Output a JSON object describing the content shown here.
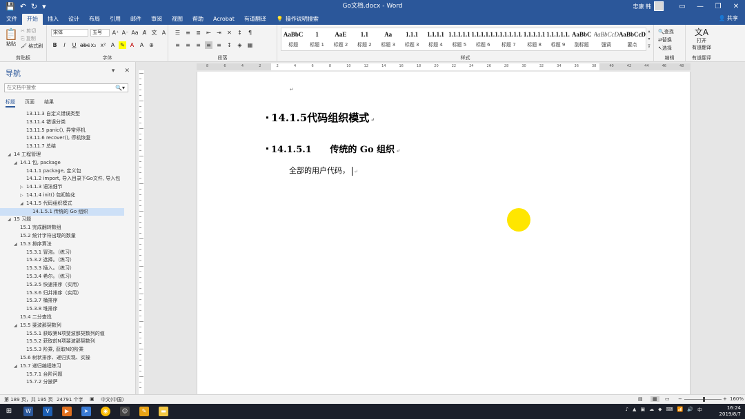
{
  "window": {
    "title": "Go文档.docx  -  Word",
    "user_name": "忠康 韩"
  },
  "quick_access": {
    "save_icon": "save-icon",
    "undo_icon": "undo-icon",
    "redo_icon": "redo-icon"
  },
  "tabs": [
    "文件",
    "开始",
    "插入",
    "设计",
    "布局",
    "引用",
    "邮件",
    "审阅",
    "视图",
    "帮助",
    "Acrobat",
    "有道翻译"
  ],
  "active_tab": "开始",
  "tell_me": "操作说明搜索",
  "share": "共享",
  "ribbon": {
    "clipboard": {
      "label": "剪贴板",
      "paste": "粘贴",
      "cut": "剪切",
      "copy": "复制",
      "format_painter": "格式刷"
    },
    "font": {
      "label": "字体",
      "font_name": "宋体",
      "font_size": "五号"
    },
    "paragraph": {
      "label": "段落"
    },
    "styles": {
      "label": "样式",
      "items": [
        {
          "sample": "AaBbC",
          "name": "标题"
        },
        {
          "sample": "1",
          "name": "标题 1"
        },
        {
          "sample": "AaE",
          "name": "标题 2"
        },
        {
          "sample": "1.1",
          "name": "标题 2"
        },
        {
          "sample": "Aa",
          "name": "标题 3"
        },
        {
          "sample": "1.1.1",
          "name": "标题 3"
        },
        {
          "sample": "1.1.1.1",
          "name": "标题 4"
        },
        {
          "sample": "1.1.1.1.1",
          "name": "标题 5"
        },
        {
          "sample": "1.1.1.1.1.",
          "name": "标题 6"
        },
        {
          "sample": "1.1.1.1.1.1.",
          "name": "标题 7"
        },
        {
          "sample": "1.1.1.1.1",
          "name": "标题 8"
        },
        {
          "sample": "1.1.1.1.1.",
          "name": "标题 9"
        },
        {
          "sample": "AaBbC",
          "name": "副标题"
        },
        {
          "sample": "AaBbCcD",
          "name": "强调"
        },
        {
          "sample": "AaBbCcD",
          "name": "要点"
        }
      ]
    },
    "editing": {
      "label": "编辑",
      "find": "查找",
      "replace": "替换",
      "select": "选择"
    },
    "youdao": {
      "label": "有道翻译",
      "open": "打开",
      "open2": "有道翻译"
    }
  },
  "nav": {
    "title": "导航",
    "search_placeholder": "在文档中搜索",
    "tabs": [
      "标题",
      "页面",
      "结果"
    ],
    "items": [
      {
        "text": "13.11.3 自定义错误类型",
        "level": 3,
        "toggle": ""
      },
      {
        "text": "13.11.4 错误分类",
        "level": 3,
        "toggle": ""
      },
      {
        "text": "13.11.5 panic(), 异常停机",
        "level": 3,
        "toggle": ""
      },
      {
        "text": "13.11.6 recover(), 停机恢复",
        "level": 3,
        "toggle": ""
      },
      {
        "text": "13.11.7 总结",
        "level": 3,
        "toggle": ""
      },
      {
        "text": "14 工程管理",
        "level": 1,
        "toggle": "◢"
      },
      {
        "text": "14.1 包, package",
        "level": 2,
        "toggle": "◢"
      },
      {
        "text": "14.1.1 package, 定义包",
        "level": 3,
        "toggle": ""
      },
      {
        "text": "14.1.2 import, 导入目录下Go文件, 导入包",
        "level": 3,
        "toggle": ""
      },
      {
        "text": "14.1.3 语法细节",
        "level": 3,
        "toggle": "▷"
      },
      {
        "text": "14.1.4 init() 包初始化",
        "level": 3,
        "toggle": "▷"
      },
      {
        "text": "14.1.5 代码组织模式",
        "level": 3,
        "toggle": "◢"
      },
      {
        "text": "14.1.5.1 传统的 Go 组织",
        "level": 4,
        "toggle": "",
        "selected": true
      },
      {
        "text": "15 习题",
        "level": 1,
        "toggle": "◢"
      },
      {
        "text": "15.1 完成翻转数组",
        "level": 2,
        "toggle": ""
      },
      {
        "text": "15.2 统计字符出现的数量",
        "level": 2,
        "toggle": ""
      },
      {
        "text": "15.3 排序算法",
        "level": 2,
        "toggle": "◢"
      },
      {
        "text": "15.3.1 冒泡。（练习）",
        "level": 3,
        "toggle": ""
      },
      {
        "text": "15.3.2 选择。（练习）",
        "level": 3,
        "toggle": ""
      },
      {
        "text": "15.3.3 插入。（练习）",
        "level": 3,
        "toggle": ""
      },
      {
        "text": "15.3.4 希尔。（练习）",
        "level": 3,
        "toggle": ""
      },
      {
        "text": "15.3.5 快速排序（实用）",
        "level": 3,
        "toggle": ""
      },
      {
        "text": "15.3.6 归并排序（实用）",
        "level": 3,
        "toggle": ""
      },
      {
        "text": "15.3.7 桶排序",
        "level": 3,
        "toggle": ""
      },
      {
        "text": "15.3.8 堆排序",
        "level": 3,
        "toggle": ""
      },
      {
        "text": "15.4 二分查找",
        "level": 2,
        "toggle": ""
      },
      {
        "text": "15.5 斐波那契数列",
        "level": 2,
        "toggle": "◢"
      },
      {
        "text": "15.5.1 获取第N项斐波那契数列的值",
        "level": 3,
        "toggle": ""
      },
      {
        "text": "15.5.2 获取前N项斐波那契数列",
        "level": 3,
        "toggle": ""
      },
      {
        "text": "15.5.3 阶乘, 获取N的阶乘",
        "level": 3,
        "toggle": ""
      },
      {
        "text": "15.6 树状排序、递归实现、实操",
        "level": 2,
        "toggle": ""
      },
      {
        "text": "15.7 递归编程练习",
        "level": 2,
        "toggle": "◢"
      },
      {
        "text": "15.7.1 台阶问题",
        "level": 3,
        "toggle": ""
      },
      {
        "text": "15.7.2 分披萨",
        "level": 3,
        "toggle": ""
      }
    ]
  },
  "document": {
    "heading3": "14.1.5代码组织模式",
    "heading4_number": "14.1.5.1",
    "heading4_text": "传统的 Go 组织",
    "body": "全部的用户代码，",
    "para_mark": "↵"
  },
  "ruler_numbers": [
    "8",
    "6",
    "4",
    "2",
    "2",
    "4",
    "6",
    "8",
    "10",
    "12",
    "14",
    "16",
    "18",
    "20",
    "22",
    "24",
    "26",
    "28",
    "30",
    "32",
    "34",
    "36",
    "38",
    "40",
    "42",
    "44",
    "46",
    "48"
  ],
  "status": {
    "page": "第 189 页，共 195 页",
    "words": "24791 个字",
    "language": "中文(中国)",
    "zoom": "160%"
  },
  "taskbar": {
    "time": "16:24",
    "date": "2019/8/7"
  },
  "colors": {
    "word_blue": "#2b579a",
    "cursor_highlight": "#ffe600"
  }
}
